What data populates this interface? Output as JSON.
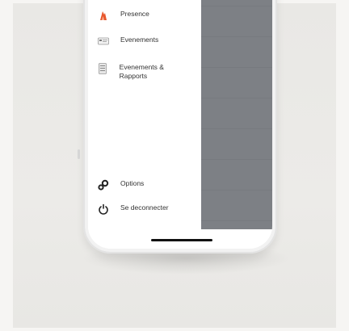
{
  "menu": {
    "items": [
      {
        "label": "Presence",
        "icon": "flame-icon"
      },
      {
        "label": "Evenements",
        "icon": "event-card-icon"
      },
      {
        "label": "Evenements & Rapports",
        "icon": "report-document-icon"
      }
    ],
    "bottom": [
      {
        "label": "Options",
        "icon": "gear-link-icon"
      },
      {
        "label": "Se deconnecter",
        "icon": "power-icon"
      }
    ]
  },
  "colors": {
    "accent": "#e8572d",
    "overlay": "#7d8085",
    "background": "#ecebe8"
  }
}
